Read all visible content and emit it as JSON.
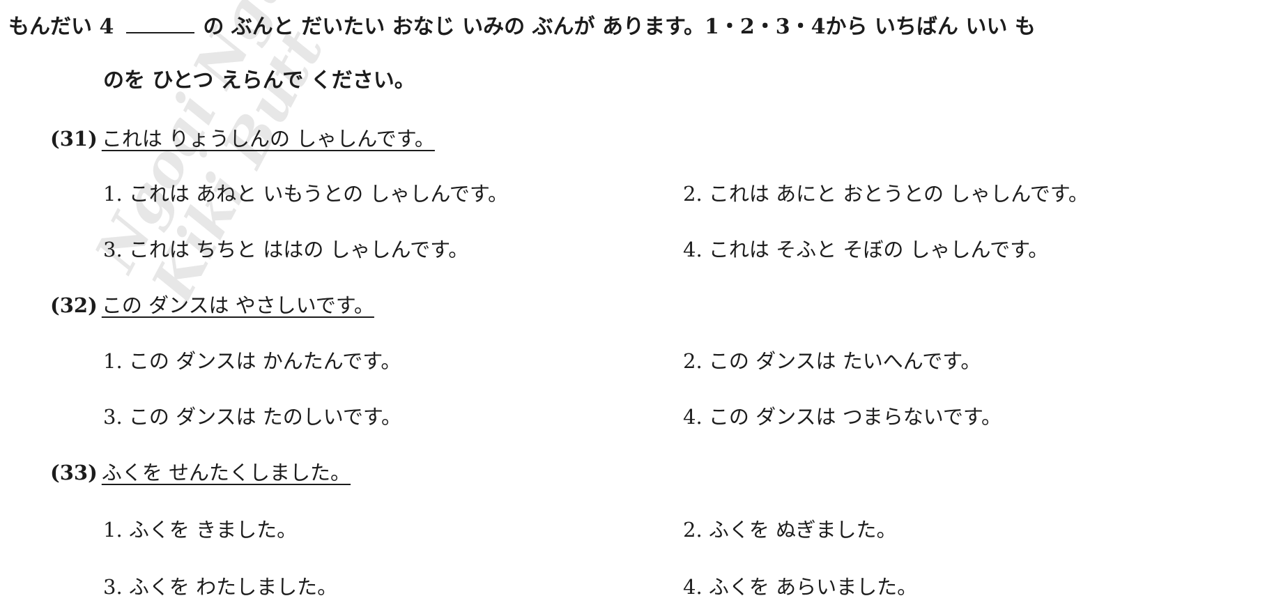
{
  "instruction": {
    "prefix": "もんだい 4",
    "line1_rest": "の ぶんと だいたい おなじ いみの ぶんが あります。1・2・3・4から いちばん いい も",
    "line2": "のを ひとつ えらんで ください。"
  },
  "watermark": {
    "lines": [
      "Ngoại Ngữ Group",
      "Kiki Butt"
    ]
  },
  "questions": [
    {
      "number": "(31)",
      "text": "これは りょうしんの しゃしんです。",
      "options": [
        "1. これは あねと いもうとの しゃしんです。",
        "2. これは あにと おとうとの しゃしんです。",
        "3. これは ちちと ははの しゃしんです。",
        "4. これは そふと そぼの しゃしんです。"
      ]
    },
    {
      "number": "(32)",
      "text": "この ダンスは やさしいです。",
      "options": [
        "1. この ダンスは かんたんです。",
        "2. この ダンスは たいへんです。",
        "3. この ダンスは たのしいです。",
        "4. この ダンスは つまらないです。"
      ]
    },
    {
      "number": "(33)",
      "text": "ふくを せんたくしました。",
      "options": [
        "1. ふくを きました。",
        "2. ふくを ぬぎました。",
        "3. ふくを わたしました。",
        "4. ふくを あらいました。"
      ]
    }
  ]
}
